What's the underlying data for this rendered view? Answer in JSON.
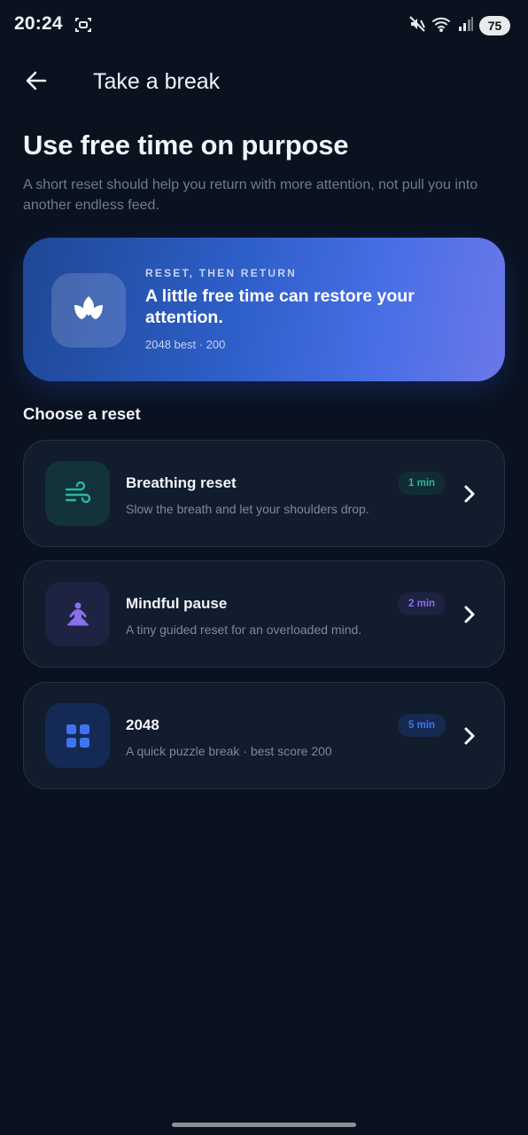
{
  "status_bar": {
    "time": "20:24",
    "battery": "75",
    "icons": [
      "screenshot-icon",
      "mute-icon",
      "wifi-icon",
      "signal-icon"
    ]
  },
  "header": {
    "back_icon": "arrow-left-icon",
    "title": "Take a break"
  },
  "intro": {
    "headline": "Use free time on purpose",
    "subtext": "A short reset should help you return with more attention, not pull you into another endless feed."
  },
  "hero": {
    "icon": "lotus-icon",
    "eyebrow": "RESET, THEN RETURN",
    "title": "A little free time can restore your attention.",
    "meta": "2048 best · 200"
  },
  "section_title": "Choose a reset",
  "resets": [
    {
      "title": "Breathing reset",
      "description": "Slow the breath and let your shoulders drop.",
      "duration": "1 min",
      "icon": "wind-icon",
      "accent": "#2bb6a4",
      "icon_bg": "#13333a",
      "badge_bg": "#112d33"
    },
    {
      "title": "Mindful pause",
      "description": "A tiny guided reset for an overloaded mind.",
      "duration": "2 min",
      "icon": "meditation-icon",
      "accent": "#8a6fe8",
      "icon_bg": "#1d2342",
      "badge_bg": "#1d2240"
    },
    {
      "title": "2048",
      "description": "A quick puzzle break · best score 200",
      "duration": "5 min",
      "icon": "grid-icon",
      "accent": "#3f73f0",
      "icon_bg": "#142a55",
      "badge_bg": "#152a50"
    }
  ],
  "colors": {
    "background": "#0a1220",
    "card": "#111c2c",
    "hero_gradient_start": "#1f4795",
    "hero_gradient_end": "#6b78e8"
  }
}
